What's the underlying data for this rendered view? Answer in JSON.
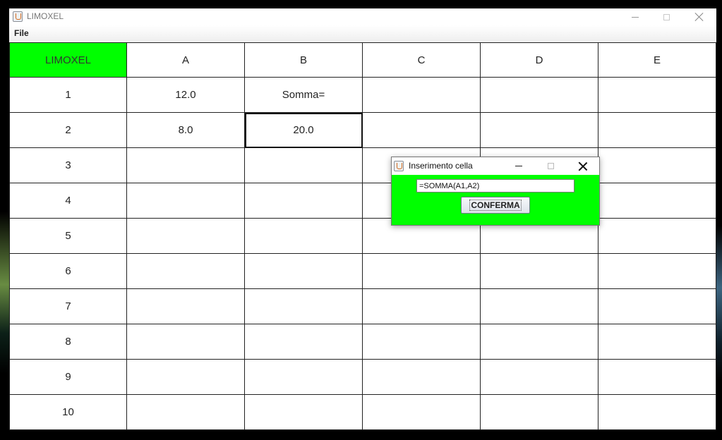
{
  "window": {
    "title": "LIMOXEL",
    "icon": "java-cup-icon"
  },
  "menu": {
    "items": [
      "File"
    ]
  },
  "sheet": {
    "corner_label": "LIMOXEL",
    "columns": [
      "A",
      "B",
      "C",
      "D",
      "E"
    ],
    "rows": [
      {
        "label": "1",
        "cells": [
          "12.0",
          "Somma=",
          "",
          "",
          ""
        ]
      },
      {
        "label": "2",
        "cells": [
          "8.0",
          "20.0",
          "",
          "",
          ""
        ]
      },
      {
        "label": "3",
        "cells": [
          "",
          "",
          "",
          "",
          ""
        ]
      },
      {
        "label": "4",
        "cells": [
          "",
          "",
          "",
          "",
          ""
        ]
      },
      {
        "label": "5",
        "cells": [
          "",
          "",
          "",
          "",
          ""
        ]
      },
      {
        "label": "6",
        "cells": [
          "",
          "",
          "",
          "",
          ""
        ]
      },
      {
        "label": "7",
        "cells": [
          "",
          "",
          "",
          "",
          ""
        ]
      },
      {
        "label": "8",
        "cells": [
          "",
          "",
          "",
          "",
          ""
        ]
      },
      {
        "label": "9",
        "cells": [
          "",
          "",
          "",
          "",
          ""
        ]
      },
      {
        "label": "10",
        "cells": [
          "",
          "",
          "",
          "",
          ""
        ]
      }
    ],
    "selected_cell": "B2",
    "corner_color": "#00ff00"
  },
  "dialog": {
    "title": "Inserimento cella",
    "icon": "java-cup-icon",
    "input_value": "=SOMMA(A1,A2)",
    "button_label": "CONFERMA",
    "background_color": "#00ff00"
  }
}
